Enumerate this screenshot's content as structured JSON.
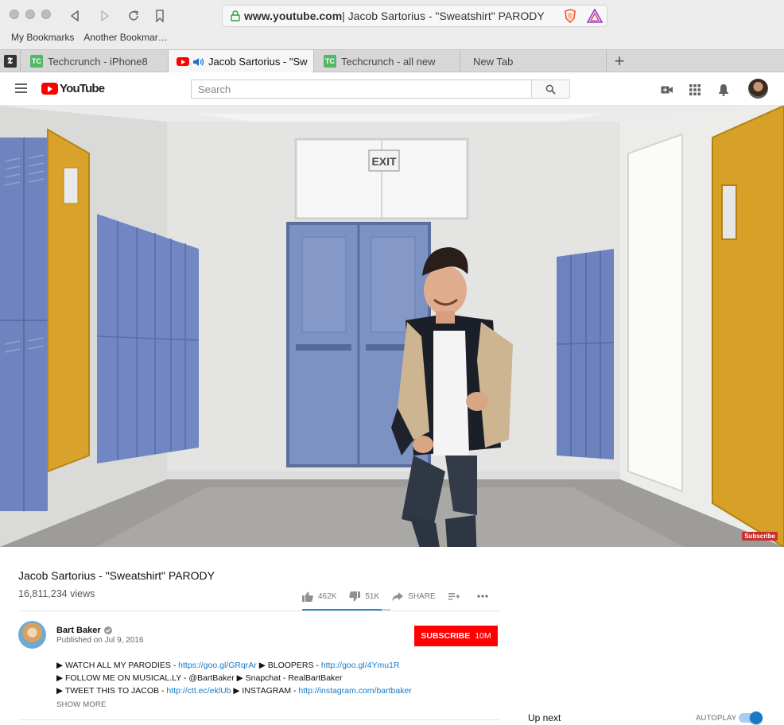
{
  "browser": {
    "url_host": "www.youtube.com",
    "url_rest": " | Jacob Sartorius - \"Sweatshirt\" PARODY",
    "bookmarks": [
      "My Bookmarks",
      "Another Bookmar…"
    ],
    "tabs": [
      {
        "label": "Techcrunch - iPhone8",
        "favicon": "techcrunch-icon"
      },
      {
        "label": "Jacob Sartorius - \"Sw",
        "favicon": "youtube-icon",
        "active": true,
        "audio": true
      },
      {
        "label": "Techcrunch - all new",
        "favicon": "techcrunch-icon"
      },
      {
        "label": "New Tab"
      }
    ],
    "new_tab_glyph": "+"
  },
  "youtube": {
    "logo_text": "YouTube",
    "search_placeholder": "Search",
    "brand_red": "#ff0000",
    "link_blue": "#167ac6"
  },
  "video": {
    "title": "Jacob Sartorius - \"Sweatshirt\" PARODY",
    "views": "16,811,234 views",
    "likes": "462K",
    "dislikes": "51K",
    "share_label": "SHARE",
    "like_ratio": 0.9,
    "exit_sign": "EXIT",
    "endcard_label": "Subscribe"
  },
  "owner": {
    "name": "Bart Baker",
    "published": "Published on Jul 9, 2016",
    "subscribe_label": "SUBSCRIBE",
    "subscriber_count": "10M"
  },
  "description": {
    "line1_a": "▶ WATCH ALL MY PARODIES - ",
    "line1_link1": "https://goo.gl/GRqrAr",
    "line1_b": " ▶ BLOOPERS - ",
    "line1_link2": "http://goo.gl/4Ymu1R",
    "line2": "▶ FOLLOW ME ON MUSICAL.LY - @BartBaker ▶ Snapchat - RealBartBaker",
    "line3_a": "▶ TWEET THIS TO JACOB - ",
    "line3_link1": "http://ctt.ec/eklUb",
    "line3_b": " ▶ INSTAGRAM - ",
    "line3_link2": "http://instagram.com/bartbaker",
    "show_more": "SHOW MORE"
  },
  "sidebar": {
    "up_next": "Up next",
    "autoplay": "AUTOPLAY",
    "autoplay_on": true
  }
}
